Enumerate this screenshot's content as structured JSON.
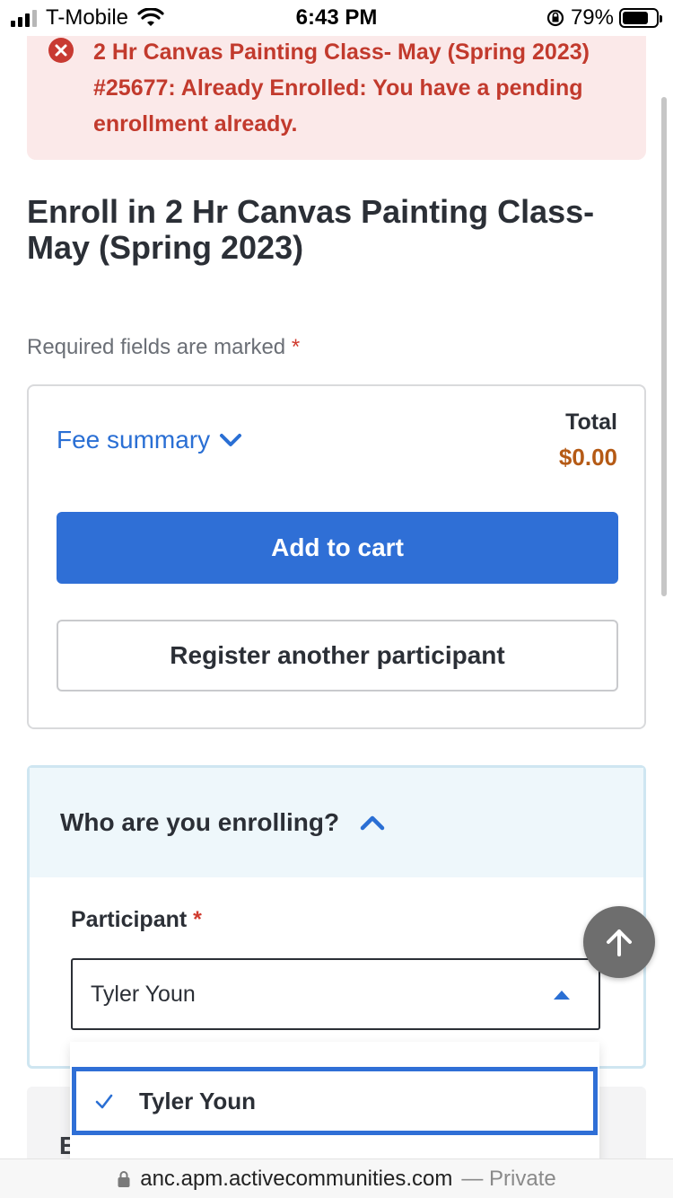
{
  "status_bar": {
    "carrier": "T-Mobile",
    "time": "6:43 PM",
    "battery_percent": "79%",
    "battery_level": 0.79,
    "icons": [
      "signal-icon",
      "wifi-icon",
      "rotation-lock-icon",
      "battery-icon"
    ]
  },
  "alert": {
    "message": "2 Hr Canvas Painting Class- May (Spring 2023) #25677: Already Enrolled: You have a pending enrollment already.",
    "icon": "error-circle-icon",
    "color": "#c23a2d",
    "background": "#fbe9e9"
  },
  "page": {
    "title": "Enroll in 2 Hr Canvas Painting Class- May (Spring 2023)",
    "required_note": "Required fields are marked",
    "required_marker": "*"
  },
  "summary": {
    "fee_summary_label": "Fee summary",
    "total_label": "Total",
    "total_value": "$0.00",
    "add_to_cart_label": "Add to cart",
    "register_another_label": "Register another participant",
    "accent_color": "#2f6fd6",
    "total_color": "#b55a15"
  },
  "enrolling": {
    "title": "Who are you enrolling?",
    "participant_label": "Participant",
    "required_marker": "*",
    "selected_value": "Tyler Youn",
    "options": [
      {
        "label": "Tyler Youn",
        "selected": true
      }
    ]
  },
  "lower_card": {
    "visible_letter": "E"
  },
  "url_bar": {
    "host": "anc.apm.activecommunities.com",
    "suffix": "— Private"
  }
}
